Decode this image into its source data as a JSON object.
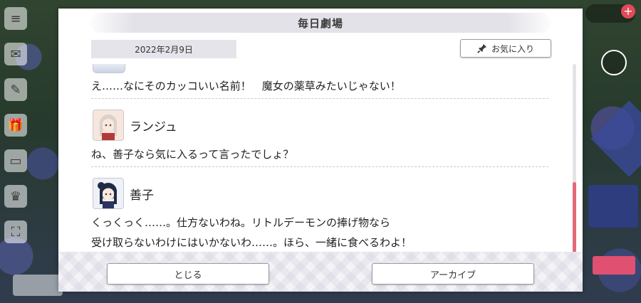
{
  "dialog": {
    "title": "毎日劇場",
    "date": "2022年2月9日",
    "favorite_label": "お気に入り"
  },
  "chat": {
    "messages": [
      {
        "speaker": "",
        "lines": [
          "え……なにそのカッコいい名前！　魔女の薬草みたいじゃない！"
        ]
      },
      {
        "speaker": "ランジュ",
        "lines": [
          "ね、善子なら気に入るって言ったでしょ？"
        ]
      },
      {
        "speaker": "善子",
        "lines": [
          "くっくっく……。仕方ないわね。リトルデーモンの捧げ物なら",
          "受け取らないわけにはいかないわ……。ほら、一緒に食べるわよ！"
        ]
      }
    ]
  },
  "footer": {
    "close_label": "とじる",
    "archive_label": "アーカイブ"
  },
  "colors": {
    "scroll_thumb": "#e36a78",
    "header_bg": "#e2e2e8"
  },
  "icons": [
    "menu-icon",
    "pin-icon",
    "gift-icon",
    "plus-icon"
  ]
}
